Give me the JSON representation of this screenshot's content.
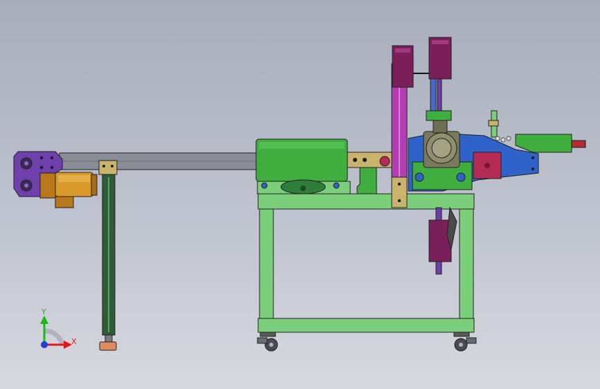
{
  "colors": {
    "background_top": "#a7adbb",
    "background_bottom": "#d7d9e0",
    "frame_green": "#7ccf7a",
    "housing_green": "#3fae3f",
    "dark_green": "#2e5c38",
    "magenta": "#b23fb2",
    "dark_magenta": "#7a1f5a",
    "blue": "#2f63c9",
    "gold": "#c58a22",
    "tan": "#c9b36d",
    "gray_arm": "#8a8d95",
    "purple": "#6f3fae",
    "axis_x": "#e01818",
    "axis_y": "#18b818",
    "axis_origin": "#1f3fd8"
  },
  "axis_triad": {
    "x_label": "X",
    "y_label": "Y"
  }
}
